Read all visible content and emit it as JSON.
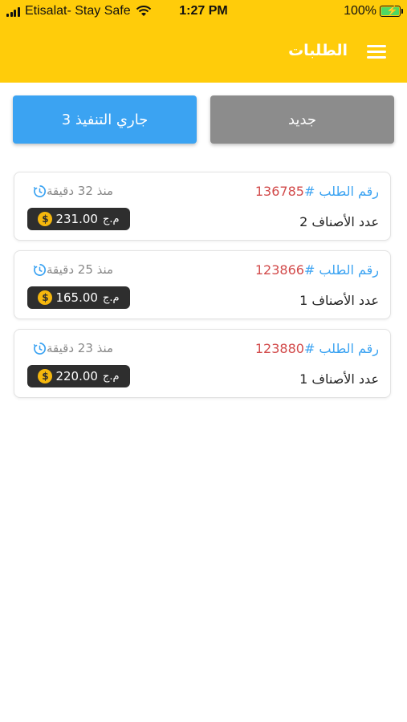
{
  "status_bar": {
    "carrier": "Etisalat- Stay Safe",
    "time": "1:27 PM",
    "battery": "100%"
  },
  "header": {
    "title": "الطلبات",
    "menu_icon": "hamburger-menu-icon"
  },
  "tabs": [
    {
      "label": "جديد",
      "color": "#8C8C8C"
    },
    {
      "label": "جاري التنفيذ 3",
      "color": "#3BA3F2"
    }
  ],
  "orders": [
    {
      "order_label": "رقم الطلب #",
      "order_number": "136785",
      "items_text": "عدد الأصناف 2",
      "time_ago": "منذ 32 دقيقة",
      "price": "231.00",
      "currency": "م.ج"
    },
    {
      "order_label": "رقم الطلب #",
      "order_number": "123866",
      "items_text": "عدد الأصناف 1",
      "time_ago": "منذ 25 دقيقة",
      "price": "165.00",
      "currency": "م.ج"
    },
    {
      "order_label": "رقم الطلب #",
      "order_number": "123880",
      "items_text": "عدد الأصناف 1",
      "time_ago": "منذ 23 دقيقة",
      "price": "220.00",
      "currency": "م.ج"
    }
  ],
  "colors": {
    "header_bg": "#FFCC0A",
    "order_number": "#D24B4B",
    "order_label": "#3BA3F2",
    "price_badge": "#2E2E2E",
    "coin": "#F5B70D"
  }
}
